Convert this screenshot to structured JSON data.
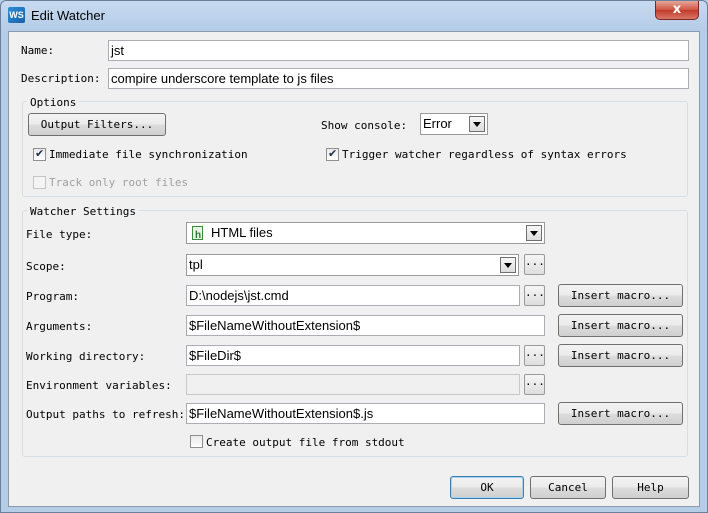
{
  "window": {
    "title": "Edit Watcher",
    "close_glyph": "x",
    "icon_text": "WS"
  },
  "form": {
    "name_label": "Name:",
    "name_value": "jst",
    "description_label": "Description:",
    "description_value": "compire underscore template to js files"
  },
  "options": {
    "title": "Options",
    "output_filters_button": "Output Filters...",
    "show_console_label": "Show console:",
    "show_console_value": "Error",
    "immediate_sync_label": "Immediate file synchronization",
    "immediate_sync_checked": true,
    "trigger_watcher_label": "Trigger watcher regardless of syntax errors",
    "trigger_watcher_checked": true,
    "track_root_label": "Track only root files",
    "track_root_checked": false
  },
  "watcher": {
    "title": "Watcher Settings",
    "file_type_label": "File type:",
    "file_type_value": "HTML files",
    "scope_label": "Scope:",
    "scope_value": "tpl",
    "program_label": "Program:",
    "program_value": "D:\\nodejs\\jst.cmd",
    "arguments_label": "Arguments:",
    "arguments_value": "$FileNameWithoutExtension$",
    "working_dir_label": "Working directory:",
    "working_dir_value": "$FileDir$",
    "env_vars_label": "Environment variables:",
    "env_vars_value": "",
    "output_paths_label": "Output paths to refresh:",
    "output_paths_value": "$FileNameWithoutExtension$.js",
    "create_output_label": "Create output file from stdout",
    "create_output_checked": false,
    "insert_macro_label": "Insert macro...",
    "browse_label": "..."
  },
  "footer": {
    "ok": "OK",
    "cancel": "Cancel",
    "help": "Help"
  },
  "icons": {
    "app": "webstorm-logo-icon",
    "file_type": "html-file-icon",
    "dropdown": "chevron-down-icon",
    "close": "close-icon"
  }
}
